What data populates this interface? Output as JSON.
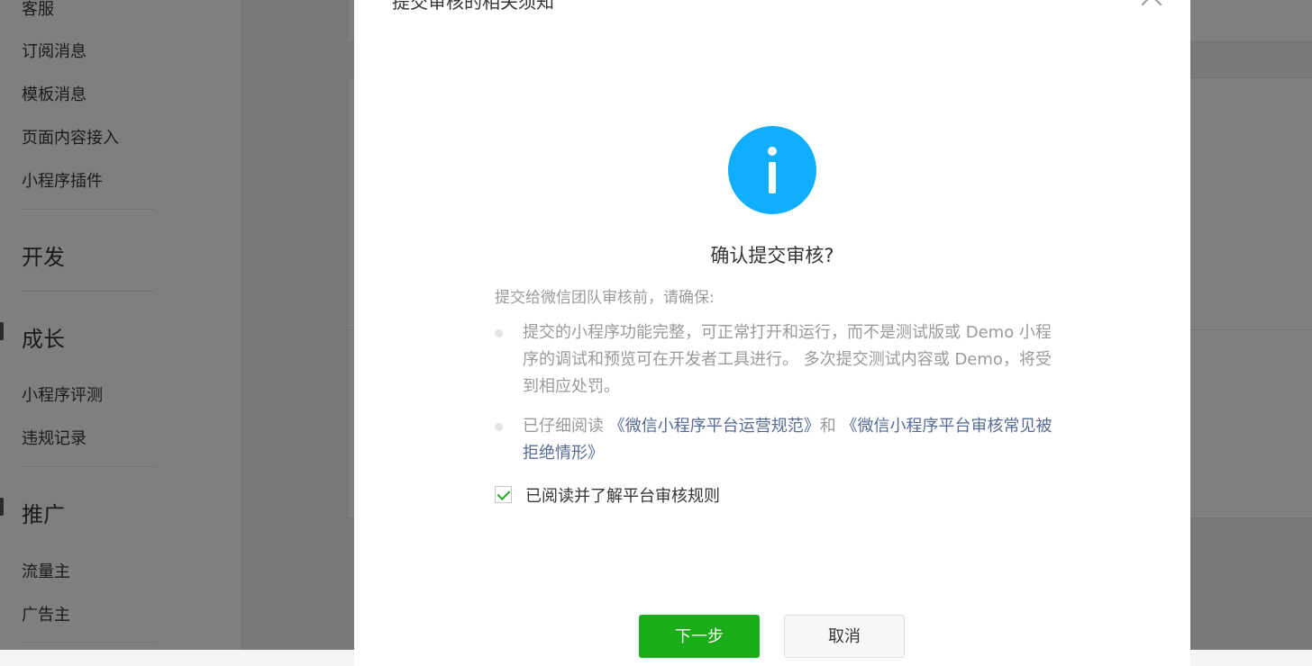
{
  "sidebar": {
    "items_top": [
      {
        "label": "客服"
      },
      {
        "label": "订阅消息"
      },
      {
        "label": "模板消息"
      },
      {
        "label": "页面内容接入"
      },
      {
        "label": "小程序插件"
      }
    ],
    "group_dev": {
      "label": "开发"
    },
    "group_growth": {
      "label": "成长"
    },
    "growth_items": [
      {
        "label": "小程序评测"
      },
      {
        "label": "违规记录"
      }
    ],
    "group_promo": {
      "label": "推广"
    },
    "promo_items": [
      {
        "label": "流量主"
      },
      {
        "label": "广告主"
      }
    ]
  },
  "dialog": {
    "title": "提交审核的相关须知",
    "confirm_title": "确认提交审核?",
    "intro": "提交给微信团队审核前，请确保:",
    "bullet1": "提交的小程序功能完整，可正常打开和运行，而不是测试版或 Demo 小程序的调试和预览可在开发者工具进行。 多次提交测试内容或 Demo，将受到相应处罚。",
    "bullet2_prefix": "已仔细阅读 ",
    "bullet2_link1": "《微信小程序平台运营规范》",
    "bullet2_middle": "和 ",
    "bullet2_link2": "《微信小程序平台审核常见被拒绝情形》",
    "checkbox_label": "已阅读并了解平台审核规则",
    "checkbox_checked": true,
    "next_button": "下一步",
    "cancel_button": "取消"
  },
  "colors": {
    "info_icon": "#10aeff",
    "primary_button": "#1aad19",
    "link": "#576b95"
  }
}
